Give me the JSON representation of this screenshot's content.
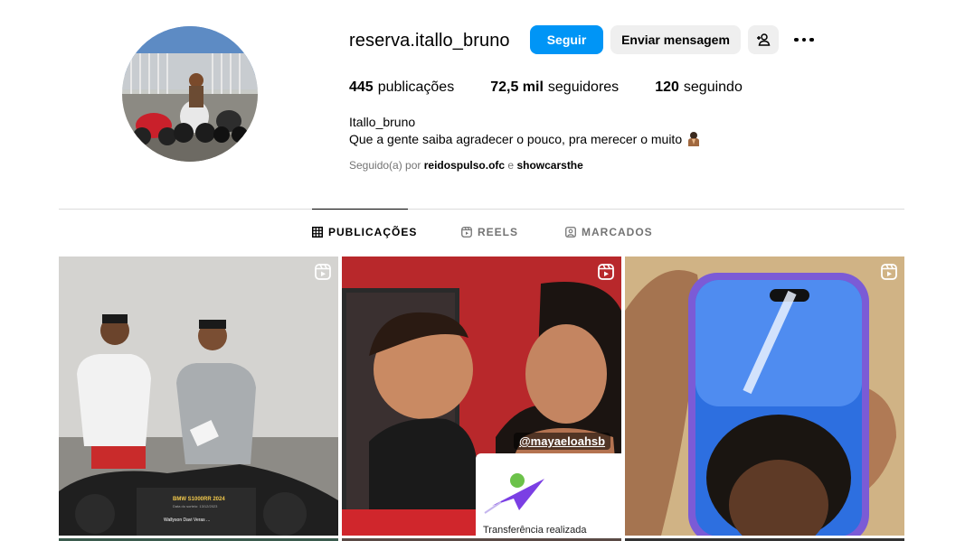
{
  "profile": {
    "username": "reserva.itallo_bruno",
    "full_name": "Itallo_bruno",
    "bio": "Que a gente saiba agradecer o pouco, pra merecer o muito",
    "bio_emoji_icon": "praying-person-emoji",
    "followed_by_prefix": "Seguido(a) por",
    "followed_by_user_1": "reidospulso.ofc",
    "followed_by_joiner": "e",
    "followed_by_user_2": "showcarsthe"
  },
  "actions": {
    "follow_label": "Seguir",
    "message_label": "Enviar mensagem",
    "suggest_icon": "add-person-icon",
    "more_icon": "more-options-icon"
  },
  "stats": {
    "posts_count": "445",
    "posts_label": "publicações",
    "followers_count": "72,5 mil",
    "followers_label": "seguidores",
    "following_count": "120",
    "following_label": "seguindo"
  },
  "tabs": [
    {
      "label": "PUBLICAÇÕES",
      "icon": "grid-icon",
      "active": true
    },
    {
      "label": "REELS",
      "icon": "reels-icon",
      "active": false
    },
    {
      "label": "MARCADOS",
      "icon": "tagged-icon",
      "active": false
    }
  ],
  "posts": [
    {
      "type": "reel",
      "bike_card_title": "BMW S1000RR 2024",
      "bike_card_date": "Data do sorteio: 13/12/2023",
      "bike_card_owner": "Wallyson Davi Veras ..."
    },
    {
      "type": "reel",
      "tag": "@mayaeloahsb",
      "card_text": "Transferência realizada"
    },
    {
      "type": "reel"
    }
  ],
  "colors": {
    "primary_button": "#0095f6",
    "secondary_button": "#efefef",
    "muted_text": "#737373",
    "divider": "#dbdbdb"
  }
}
